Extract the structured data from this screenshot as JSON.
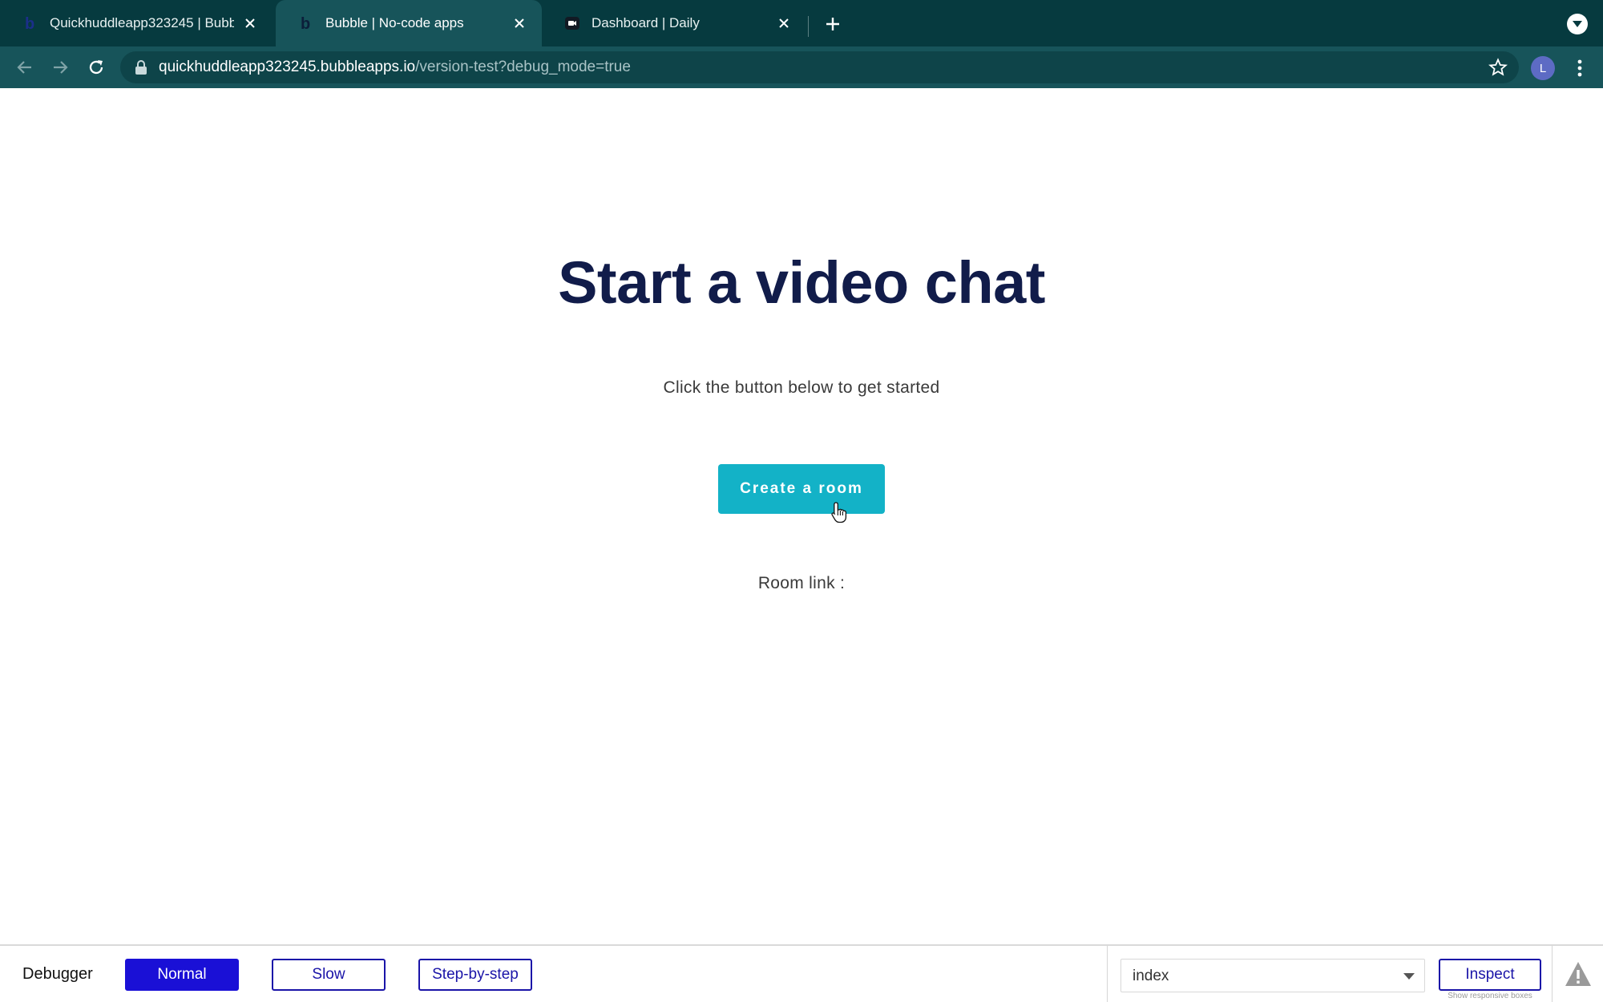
{
  "browser": {
    "tabs": [
      {
        "title": "Quickhuddleapp323245 | Bubb",
        "favicon": "bubble-logo-icon",
        "active": false
      },
      {
        "title": "Bubble | No-code apps",
        "favicon": "bubble-logo-icon",
        "active": true
      },
      {
        "title": "Dashboard | Daily",
        "favicon": "daily-logo-icon",
        "active": false
      }
    ],
    "address": {
      "host": "quickhuddleapp323245.bubbleapps.io",
      "path": "/version-test?debug_mode=true"
    },
    "profile_initial": "L",
    "colors": {
      "frame": "#063a3f",
      "toolbar": "#17545a",
      "omnibox": "#0e4449"
    }
  },
  "page": {
    "headline": "Start a video chat",
    "subtitle": "Click the button below to get started",
    "cta_label": "Create a room",
    "room_link_label": "Room link :",
    "colors": {
      "headline": "#111c4a",
      "cta": "#13b2c7"
    }
  },
  "debugger": {
    "label": "Debugger",
    "modes": [
      "Normal",
      "Slow",
      "Step-by-step"
    ],
    "selected_mode": "Normal",
    "page_select_value": "index",
    "inspect_label": "Inspect",
    "hint": "Show responsive boxes",
    "colors": {
      "primary": "#1a10d6"
    }
  }
}
